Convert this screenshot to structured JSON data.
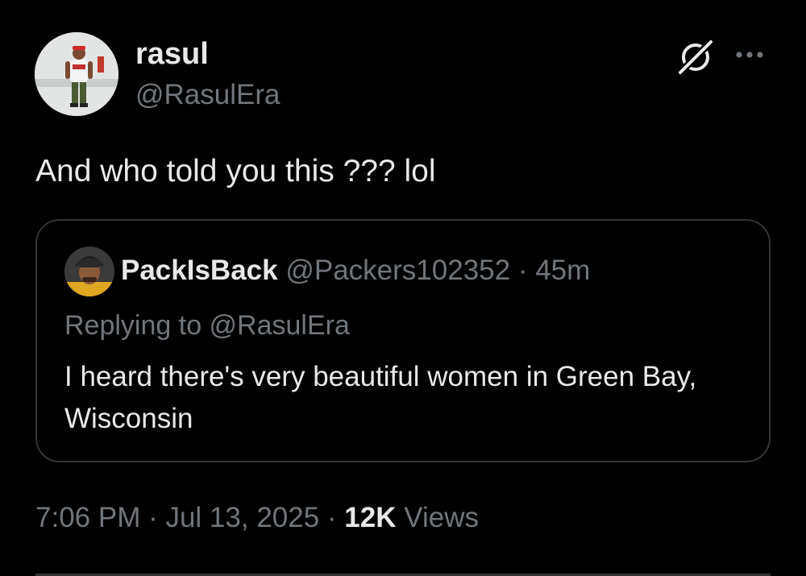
{
  "author": {
    "name": "rasul",
    "handle": "@RasulEra",
    "avatar_icon": "profile-photo"
  },
  "actions": {
    "grok_icon": "grok-slash-icon",
    "more_icon": "ellipsis-icon"
  },
  "tweet": {
    "text": "And who told you this ??? lol"
  },
  "quote": {
    "name": "PackIsBack",
    "handle": "@Packers102352",
    "separator": " · ",
    "time": "45m",
    "replying_to": "Replying to @RasulEra",
    "text": "I heard there's very beautiful women in Green Bay, Wisconsin"
  },
  "footer": {
    "time": "7:06 PM",
    "separator": " · ",
    "date": "Jul 13, 2025",
    "views_count": "12K",
    "views_label": "Views"
  },
  "colors": {
    "background": "#000000",
    "primary_text": "#e7e9ea",
    "secondary_text": "#71767b",
    "border": "#333639"
  }
}
